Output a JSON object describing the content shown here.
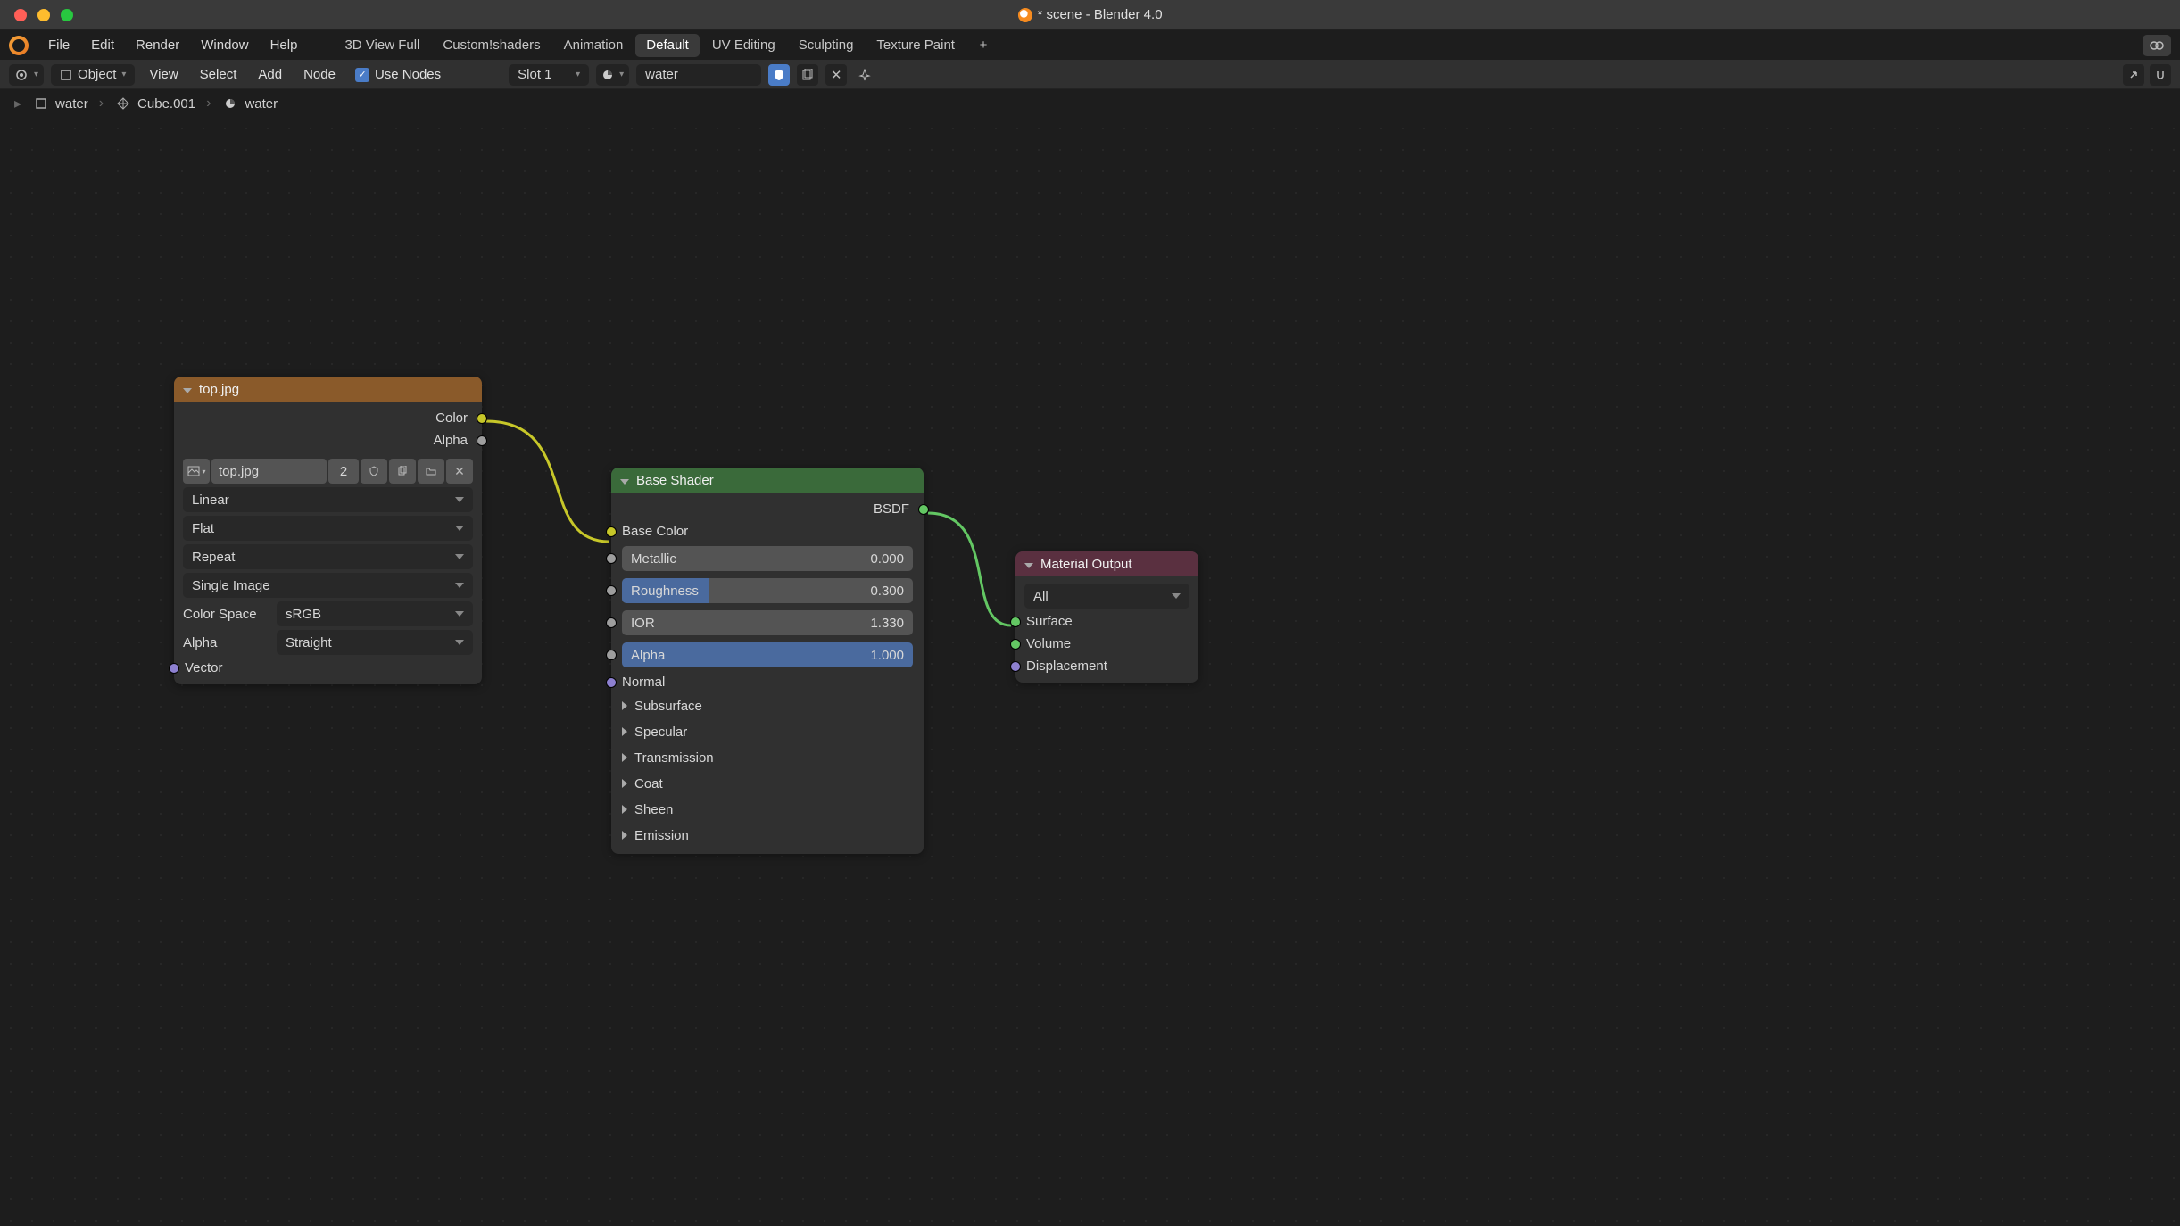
{
  "window": {
    "title": "* scene - Blender 4.0"
  },
  "topmenu": {
    "items": [
      "File",
      "Edit",
      "Render",
      "Window",
      "Help"
    ],
    "tabs": [
      "3D View Full",
      "Custom!shaders",
      "Animation",
      "Default",
      "UV Editing",
      "Sculpting",
      "Texture Paint"
    ],
    "active_tab": 3
  },
  "header": {
    "mode": "Object",
    "menus": [
      "View",
      "Select",
      "Add",
      "Node"
    ],
    "use_nodes": "Use Nodes",
    "slot": "Slot 1",
    "material_name": "water"
  },
  "breadcrumb": {
    "items": [
      "water",
      "Cube.001",
      "water"
    ]
  },
  "nodes": {
    "image": {
      "title": "top.jpg",
      "out_color": "Color",
      "out_alpha": "Alpha",
      "file": "top.jpg",
      "users": "2",
      "interp": "Linear",
      "projection": "Flat",
      "extension": "Repeat",
      "source": "Single Image",
      "color_space_label": "Color Space",
      "color_space": "sRGB",
      "alpha_label": "Alpha",
      "alpha_mode": "Straight",
      "in_vector": "Vector"
    },
    "shader": {
      "title": "Base Shader",
      "out_bsdf": "BSDF",
      "base_color": "Base Color",
      "metallic_label": "Metallic",
      "metallic": "0.000",
      "roughness_label": "Roughness",
      "roughness": "0.300",
      "ior_label": "IOR",
      "ior": "1.330",
      "alpha_label": "Alpha",
      "alpha": "1.000",
      "normal": "Normal",
      "groups": [
        "Subsurface",
        "Specular",
        "Transmission",
        "Coat",
        "Sheen",
        "Emission"
      ]
    },
    "output": {
      "title": "Material Output",
      "target": "All",
      "surface": "Surface",
      "volume": "Volume",
      "displacement": "Displacement"
    }
  }
}
